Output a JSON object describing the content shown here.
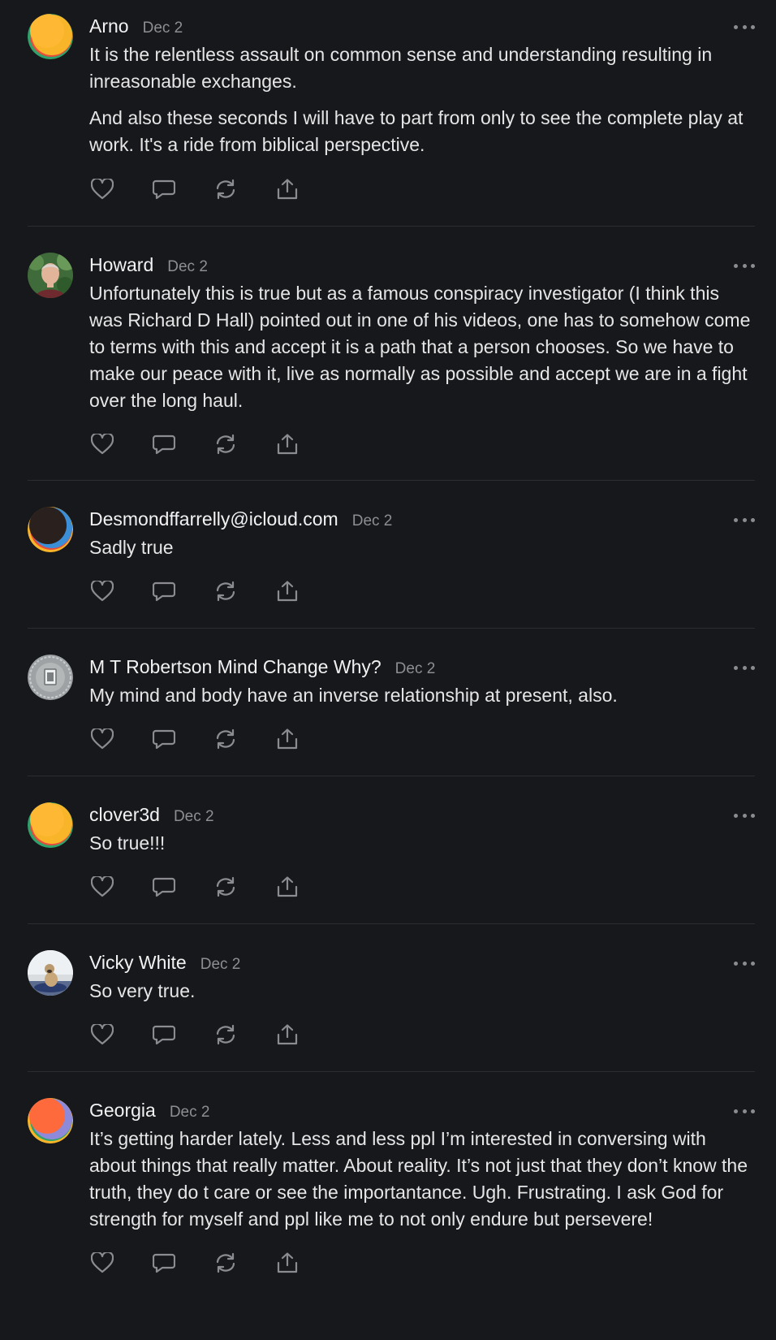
{
  "comments": [
    {
      "author": "Arno",
      "date": "Dec 2",
      "avatar": "gradient-orange",
      "paragraphs": [
        "It is the relentless assault on common sense and understanding resulting in inreasonable exchanges.",
        "And also these seconds I will have to part from only to see the complete play at work. It's a ride from biblical perspective."
      ]
    },
    {
      "author": "Howard",
      "date": "Dec 2",
      "avatar": "photo-man",
      "paragraphs": [
        "Unfortunately this is true but as a famous conspiracy investigator (I think this was Richard D Hall) pointed out in one of his videos, one has to somehow come to terms with this and accept it is a path that a person chooses. So we have to make our peace with it, live as normally as possible and accept we are in a fight over the long haul."
      ]
    },
    {
      "author": "Desmondffarrelly@icloud.com",
      "date": "Dec 2",
      "avatar": "gradient-dark",
      "paragraphs": [
        "Sadly true"
      ]
    },
    {
      "author": "M T Robertson Mind Change Why?",
      "date": "Dec 2",
      "avatar": "photo-coin",
      "paragraphs": [
        "My mind and body have an inverse relationship at present, also."
      ]
    },
    {
      "author": "clover3d",
      "date": "Dec 2",
      "avatar": "gradient-orange",
      "paragraphs": [
        "So true!!!"
      ]
    },
    {
      "author": "Vicky White",
      "date": "Dec 2",
      "avatar": "photo-dog",
      "paragraphs": [
        "So very true."
      ]
    },
    {
      "author": "Georgia",
      "date": "Dec 2",
      "avatar": "gradient-red",
      "paragraphs": [
        "It’s getting harder lately. Less and less ppl I’m interested in conversing with about things that really matter. About reality. It’s not just that they don’t know the truth, they do t care or see the importantance. Ugh. Frustrating. I ask God for strength for myself and ppl like me to not only endure but persevere!"
      ]
    }
  ],
  "icons": {
    "like": "heart-icon",
    "reply": "comment-bubble-icon",
    "restack": "restack-icon",
    "share": "share-icon",
    "more": "more-dots-icon"
  },
  "colors": {
    "background": "#17181b",
    "text": "#e6e6e7",
    "muted": "#8d8e93",
    "divider": "#2c2d31",
    "icon": "#8b8c91"
  }
}
